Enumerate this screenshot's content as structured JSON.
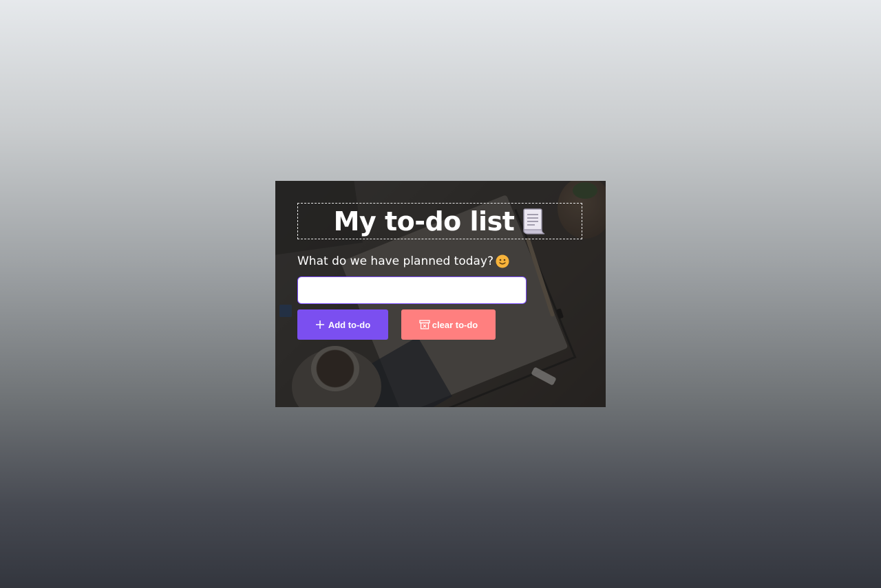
{
  "app": {
    "title": "My to-do list",
    "title_icon": "scroll-icon",
    "prompt": "What do we have planned today?",
    "prompt_icon": "slightly-smiling-face-icon"
  },
  "input": {
    "value": "",
    "placeholder": ""
  },
  "buttons": {
    "add_label": "Add to-do",
    "add_icon": "plus-icon",
    "clear_label": "clear to-do",
    "clear_icon": "archive-box-icon"
  },
  "colors": {
    "add_button": "#7b4ff0",
    "clear_button": "#ff7f7f",
    "input_border": "#7c4dff"
  }
}
